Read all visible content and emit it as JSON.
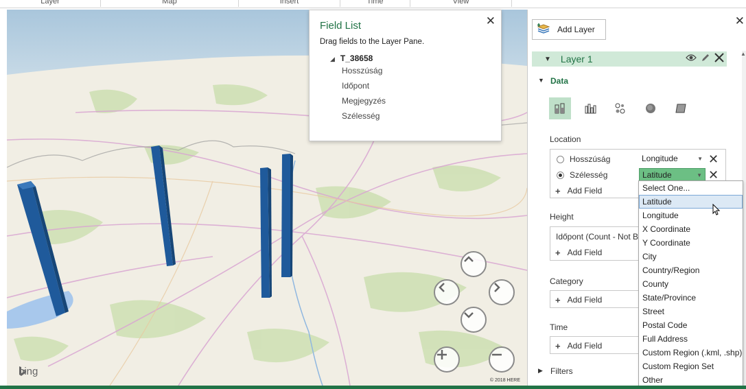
{
  "ribbon": {
    "groups": [
      "Layer",
      "Map",
      "Insert",
      "Time",
      "View"
    ]
  },
  "map": {
    "logo_text": "bing",
    "copyright": "© 2018 HERE",
    "bar_color": "#1f5a9b",
    "nav": [
      "arrow-up",
      "arrow-left",
      "arrow-right",
      "arrow-down",
      "zoom-in",
      "zoom-out"
    ]
  },
  "field_list": {
    "title": "Field List",
    "hint": "Drag fields to the Layer Pane.",
    "table": "T_38658",
    "fields": [
      "Hosszúság",
      "Időpont",
      "Megjegyzés",
      "Szélesség"
    ]
  },
  "pane": {
    "add_layer": "Add Layer",
    "layer_name": "Layer 1",
    "data_section": "Data",
    "location_label": "Location",
    "location_rows": [
      {
        "field": "Hosszúság",
        "type": "Longitude",
        "selected": false
      },
      {
        "field": "Szélesség",
        "type": "Latitude",
        "selected": true
      }
    ],
    "add_field": "Add Field",
    "height_label": "Height",
    "height_value": "Időpont (Count - Not B",
    "category_label": "Category",
    "time_label": "Time",
    "filters_label": "Filters",
    "accent": "#217346"
  },
  "dropdown": {
    "options": [
      "Select One...",
      "Latitude",
      "Longitude",
      "X Coordinate",
      "Y Coordinate",
      "City",
      "Country/Region",
      "County",
      "State/Province",
      "Street",
      "Postal Code",
      "Full Address",
      "Custom Region (.kml, .shp)",
      "Custom Region Set",
      "Other"
    ],
    "selected_index": 1
  }
}
